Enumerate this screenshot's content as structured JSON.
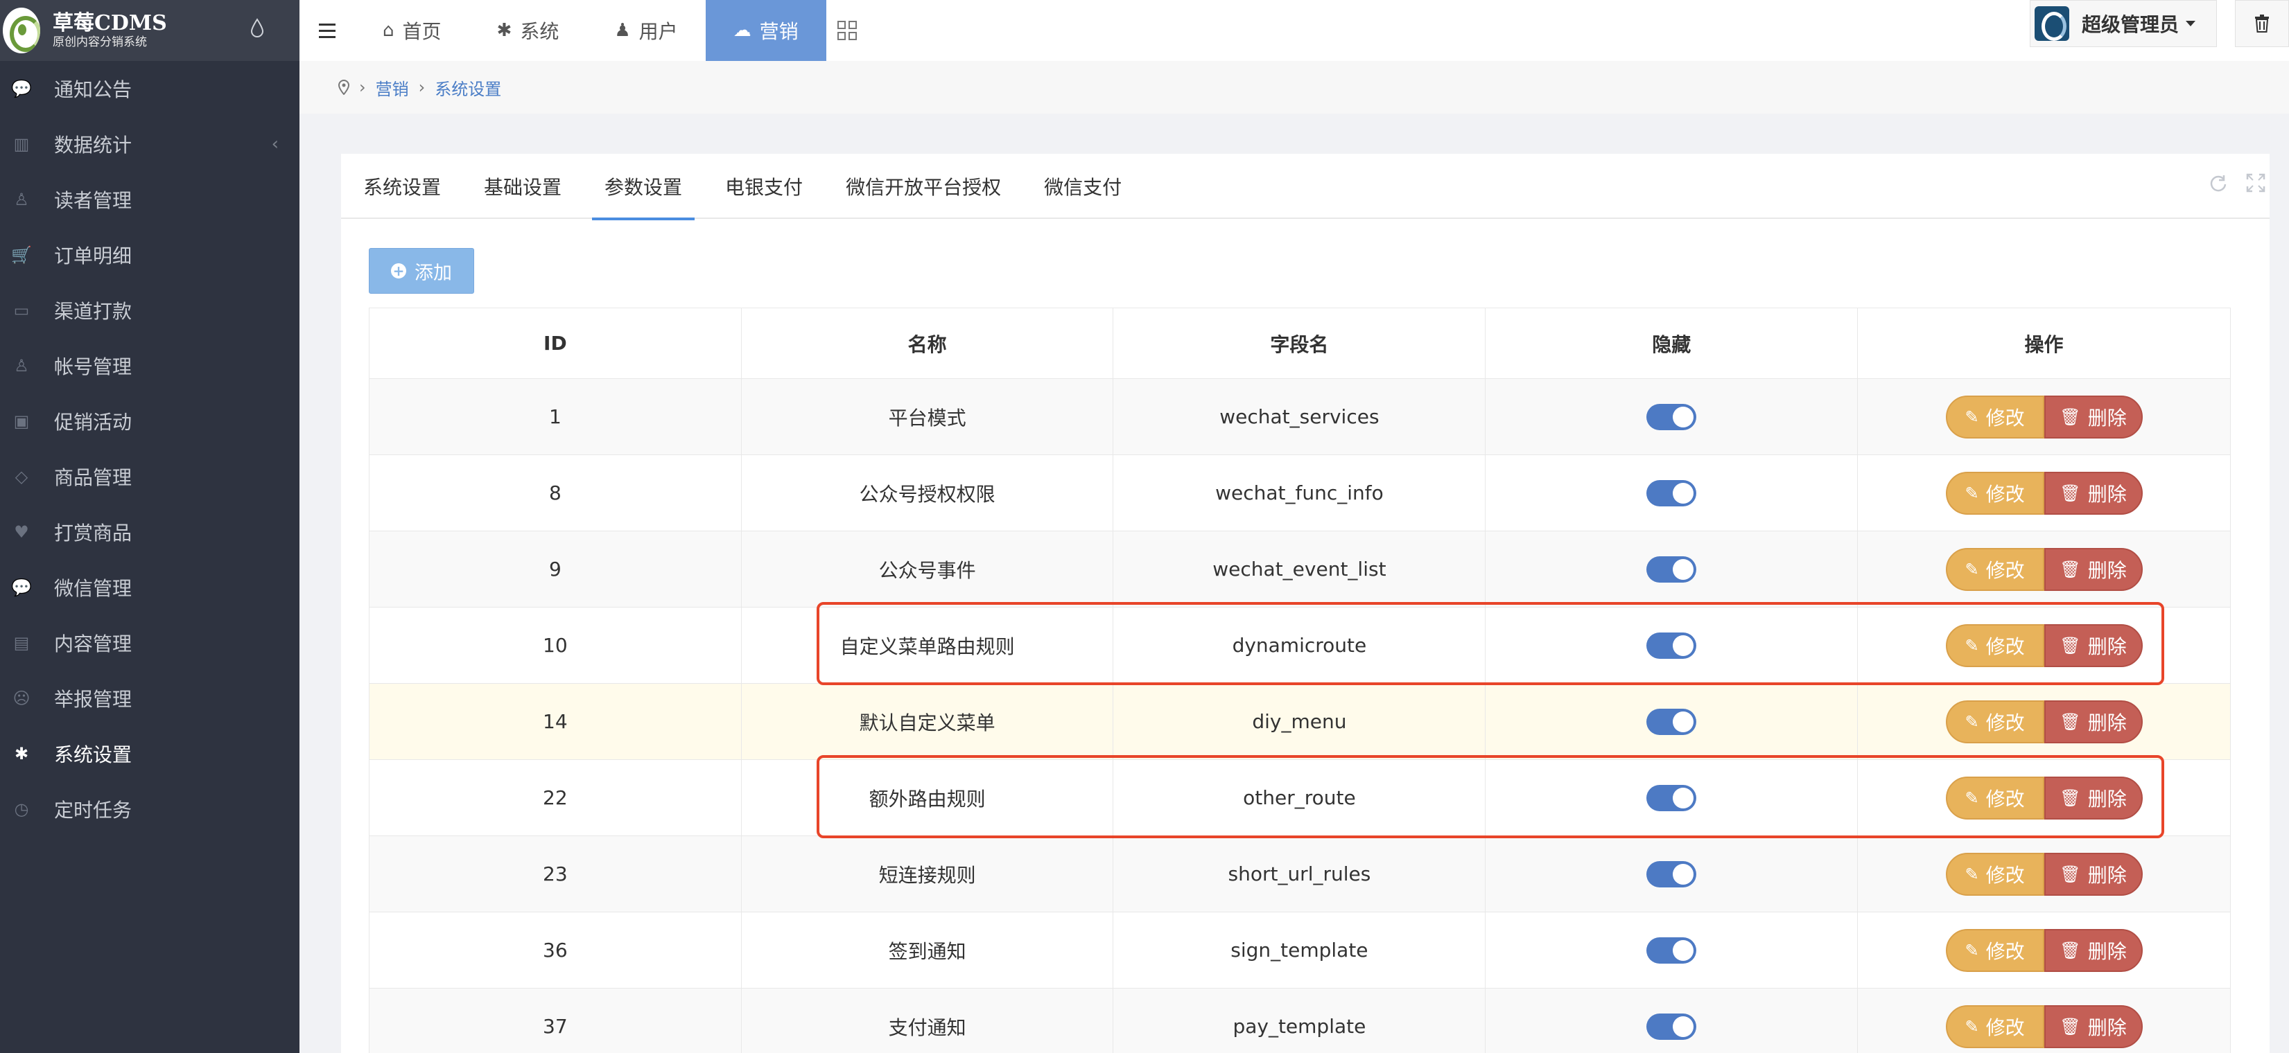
{
  "brand": {
    "title": "草莓CDMS",
    "subtitle": "原创内容分销系统"
  },
  "sidebar": {
    "items": [
      {
        "label": "通知公告",
        "icon": "comment-icon",
        "glyph": "💬"
      },
      {
        "label": "数据统计",
        "icon": "bar-chart-icon",
        "glyph": "▥",
        "arrow": "‹"
      },
      {
        "label": "读者管理",
        "icon": "user-icon",
        "glyph": "♙"
      },
      {
        "label": "订单明细",
        "icon": "cart-icon",
        "glyph": "🛒"
      },
      {
        "label": "渠道打款",
        "icon": "wechat-pay-icon",
        "glyph": "▭"
      },
      {
        "label": "帐号管理",
        "icon": "account-icon",
        "glyph": "♙"
      },
      {
        "label": "促销活动",
        "icon": "shopping-bag-icon",
        "glyph": "▣"
      },
      {
        "label": "商品管理",
        "icon": "diamond-icon",
        "glyph": "◇"
      },
      {
        "label": "打赏商品",
        "icon": "heart-icon",
        "glyph": "♥"
      },
      {
        "label": "微信管理",
        "icon": "wechat-icon",
        "glyph": "💬"
      },
      {
        "label": "内容管理",
        "icon": "book-icon",
        "glyph": "▤"
      },
      {
        "label": "举报管理",
        "icon": "frown-icon",
        "glyph": "☹"
      },
      {
        "label": "系统设置",
        "icon": "gear-icon",
        "glyph": "✱",
        "active": true
      },
      {
        "label": "定时任务",
        "icon": "clock-icon",
        "glyph": "◷"
      }
    ]
  },
  "topnav": {
    "items": [
      {
        "label": "首页",
        "glyph": "⌂"
      },
      {
        "label": "系统",
        "glyph": "✱"
      },
      {
        "label": "用户",
        "glyph": "♟"
      },
      {
        "label": "营销",
        "glyph": "☁",
        "active": true
      }
    ],
    "user": "超级管理员"
  },
  "breadcrumb": {
    "items": [
      "营销",
      "系统设置"
    ]
  },
  "tabs": [
    "系统设置",
    "基础设置",
    "参数设置",
    "电银支付",
    "微信开放平台授权",
    "微信支付"
  ],
  "active_tab": 2,
  "add_label": "添加",
  "table": {
    "headers": [
      "ID",
      "名称",
      "字段名",
      "隐藏",
      "操作"
    ],
    "edit_label": "修改",
    "delete_label": "删除",
    "rows": [
      {
        "id": "1",
        "name": "平台模式",
        "field": "wechat_services",
        "hidden": true
      },
      {
        "id": "8",
        "name": "公众号授权权限",
        "field": "wechat_func_info",
        "hidden": true
      },
      {
        "id": "9",
        "name": "公众号事件",
        "field": "wechat_event_list",
        "hidden": true
      },
      {
        "id": "10",
        "name": "自定义菜单路由规则",
        "field": "dynamicroute",
        "hidden": true
      },
      {
        "id": "14",
        "name": "默认自定义菜单",
        "field": "diy_menu",
        "hidden": true
      },
      {
        "id": "22",
        "name": "额外路由规则",
        "field": "other_route",
        "hidden": true
      },
      {
        "id": "23",
        "name": "短连接规则",
        "field": "short_url_rules",
        "hidden": true
      },
      {
        "id": "36",
        "name": "签到通知",
        "field": "sign_template",
        "hidden": true
      },
      {
        "id": "37",
        "name": "支付通知",
        "field": "pay_template",
        "hidden": true
      }
    ]
  },
  "colors": {
    "sidebar_bg": "#2e3340",
    "nav_active": "#6a97d8",
    "toggle_on": "#4d7ac4",
    "edit_btn": "#e8b35b",
    "delete_btn": "#c45f56",
    "highlight_box": "#e8452a"
  }
}
